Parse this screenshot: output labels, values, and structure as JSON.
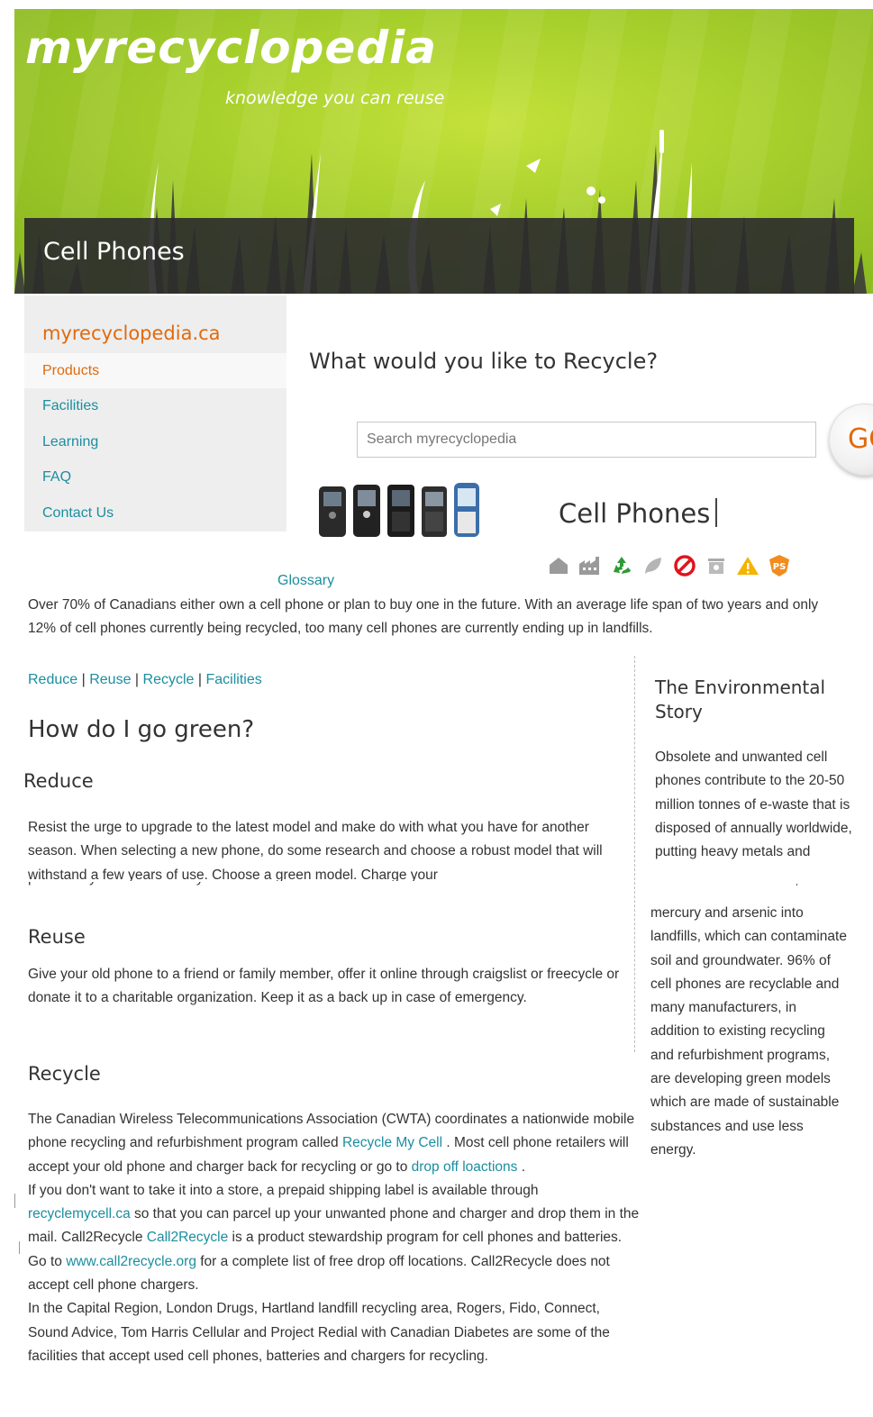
{
  "header": {
    "logo": "myrecyclopedia",
    "tagline": "knowledge you can reuse",
    "title": "Cell Phones"
  },
  "sidebar": {
    "site_name": "myrecyclopedia.ca",
    "items": [
      {
        "label": "Products",
        "active": true
      },
      {
        "label": "Facilities",
        "active": false
      },
      {
        "label": "Learning",
        "active": false
      },
      {
        "label": "FAQ",
        "active": false
      },
      {
        "label": "Contact Us",
        "active": false
      }
    ]
  },
  "search": {
    "heading": "What would you like to Recycle?",
    "placeholder": "Search myrecyclopedia",
    "value": "",
    "go_label": "GO"
  },
  "product": {
    "title": "Cell Phones",
    "image_alt": "cell phones",
    "category_icons": [
      "house-icon",
      "factory-icon",
      "recycle-icon",
      "leaf-icon",
      "prohibited-icon",
      "bin-icon",
      "warning-icon",
      "ps-icon"
    ]
  },
  "glossary_label": "Glossary",
  "intro": "Over 70% of Canadians either own a cell phone or plan to buy one in the future. With an average life span of two years and only 12% of cell phones currently being recycled, too many cell phones are currently ending up in landfills.",
  "section_links": [
    "Reduce",
    "Reuse",
    "Recycle",
    "Facilities"
  ],
  "go_green_heading": "How do I go green?",
  "reduce": {
    "heading": "Reduce",
    "text": "Resist the urge to upgrade to the latest model and make do with what you have for another season. When selecting a new phone, do some research and choose a robust model that will withstand a few years of use. Choose a green model. Charge your",
    "clipped_line": "phone only when the battery is low and turn it off when not in use."
  },
  "reuse": {
    "heading": "Reuse",
    "text": "Give your old phone to a friend or family member, offer it online through craigslist or freecycle or donate it to a charitable organization. Keep it as a back up in case of emergency."
  },
  "recycle": {
    "heading": "Recycle",
    "p1_a": "The Canadian Wireless Telecommunications Association (CWTA) coordinates a nationwide mobile phone recycling and refurbishment program called ",
    "p1_link": "Recycle My Cell",
    "p1_b": " .  Most cell phone retailers will accept your old phone and charger back for recycling or go to ",
    "p1_link2": "drop off loactions",
    "p1_c": " .",
    "p2_a": "If you don't want to take it into a store, a prepaid shipping label is available through ",
    "p2_link": "recyclemycell.ca",
    "p2_b": " so that you can parcel up your unwanted phone and charger and drop them in the mail.  Call2Recycle ",
    "p2_link2": "Call2Recycle",
    "p2_c": " is a product stewardship program for cell phones and batteries.  Go to ",
    "p2_link3": "www.call2recycle.org",
    "p2_d": " for a complete list of free drop off locations.  Call2Recycle does not accept cell phone chargers.",
    "p3": "In the Capital Region, London Drugs, Hartland landfill recycling area, Rogers, Fido, Connect, Sound Advice, Tom Harris Cellular and Project Redial with Canadian Diabetes are some of the facilities that accept used cell phones, batteries and chargers for recycling."
  },
  "aside": {
    "heading": "The Environmental Story",
    "text_a": "Obsolete and unwanted cell phones contribute to the 20-50 million tonnes of e-waste that is disposed of annually worldwide, putting heavy metals and",
    "clipped_line": "chemicals such as lead,",
    "text_b": "mercury and arsenic into landfills, which can contaminate soil and groundwater. 96% of cell phones are recyclable and many manufacturers, in addition to existing recycling and refurbishment programs, are developing green models which are made of sustainable substances and use less energy."
  },
  "colors": {
    "accent_orange": "#e06a0e",
    "link_teal": "#1b8ea0",
    "header_green": "#a6cf2c",
    "band_dark": "#2d2d2d"
  }
}
